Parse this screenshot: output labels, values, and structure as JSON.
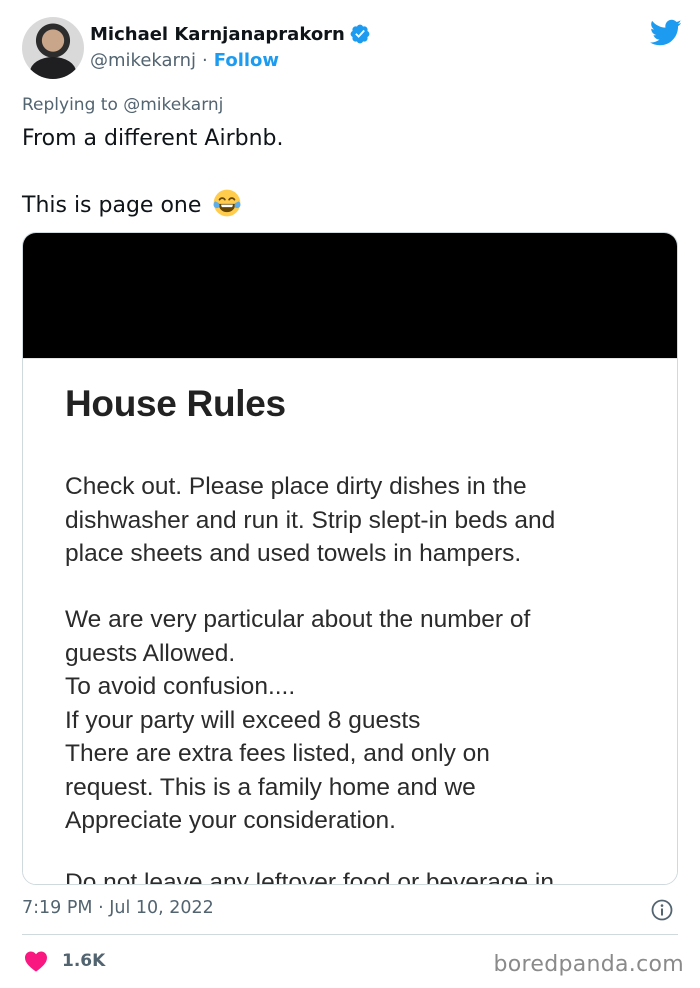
{
  "author": {
    "name": "Michael Karnjanaprakorn",
    "handle": "@mikekarnj",
    "separator": "·",
    "follow_label": "Follow",
    "verified": true,
    "avatar_icon": "person-avatar",
    "brand_icon": "twitter-bird-icon"
  },
  "tweet": {
    "reply_prefix": "Replying to",
    "reply_mention": "@mikekarnj",
    "line1": "From a different Airbnb.",
    "line2": "This is page one",
    "emoji": "face-with-tears-of-joy"
  },
  "media": {
    "document": {
      "title": "House Rules",
      "paragraphs": [
        [
          "Check out. Please place dirty dishes in the",
          "dishwasher and run it. Strip slept-in beds and",
          "place sheets and used towels in hampers."
        ],
        [
          "We are very particular about the number of",
          "guests Allowed.",
          "To avoid confusion....",
          "If your party will exceed 8 guests",
          "There are extra fees listed, and only on",
          "request.  This is a family home and we",
          "Appreciate your consideration."
        ],
        [
          "Do not leave any leftover food or beverage in"
        ]
      ]
    }
  },
  "meta": {
    "timestamp": "7:19 PM · Jul 10, 2022",
    "likes": "1.6K",
    "watermark": "boredpanda.com"
  },
  "colors": {
    "accent": "#1d9bf0",
    "heart": "#f91880",
    "muted": "#536471",
    "text": "#0f1419"
  }
}
